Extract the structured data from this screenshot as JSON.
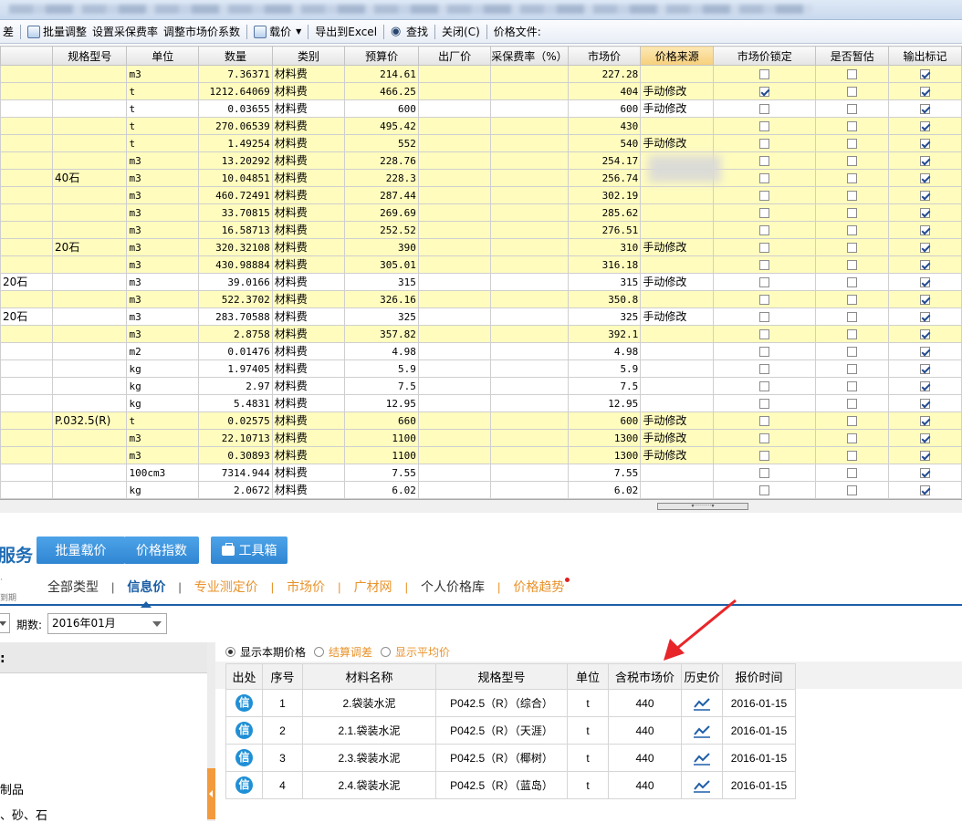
{
  "toolbar": {
    "items": [
      "差",
      "批量调整",
      "设置采保费率",
      "调整市场价系数",
      "载价",
      "导出到Excel",
      "查找",
      "关闭(C)",
      "价格文件:"
    ]
  },
  "grid": {
    "headers": [
      "",
      "规格型号",
      "单位",
      "数量",
      "类别",
      "预算价",
      "出厂价",
      "采保费率（%）",
      "市场价",
      "价格来源",
      "市场价锁定",
      "是否暂估",
      "输出标记"
    ],
    "rows": [
      {
        "name": "",
        "spec": "",
        "unit": "m3",
        "qty": "7.36371",
        "cat": "材料费",
        "budget": "214.61",
        "market": "227.28",
        "src": "",
        "lock": false,
        "est": false,
        "out": true,
        "bg": "y"
      },
      {
        "name": "",
        "spec": "",
        "unit": "t",
        "qty": "1212.64069",
        "cat": "材料费",
        "budget": "466.25",
        "market": "404",
        "src": "手动修改",
        "lock": true,
        "est": false,
        "out": true,
        "bg": "y"
      },
      {
        "name": "",
        "spec": "",
        "unit": "t",
        "qty": "0.03655",
        "cat": "材料费",
        "budget": "600",
        "market": "600",
        "src": "手动修改",
        "lock": false,
        "est": false,
        "out": true,
        "bg": "w"
      },
      {
        "name": "",
        "spec": "",
        "unit": "t",
        "qty": "270.06539",
        "cat": "材料费",
        "budget": "495.42",
        "market": "430",
        "src": "",
        "lock": false,
        "est": false,
        "out": true,
        "bg": "y"
      },
      {
        "name": "",
        "spec": "",
        "unit": "t",
        "qty": "1.49254",
        "cat": "材料费",
        "budget": "552",
        "market": "540",
        "src": "手动修改",
        "lock": false,
        "est": false,
        "out": true,
        "bg": "y"
      },
      {
        "name": "",
        "spec": "",
        "unit": "m3",
        "qty": "13.20292",
        "cat": "材料费",
        "budget": "228.76",
        "market": "254.17",
        "src": "",
        "lock": false,
        "est": false,
        "out": true,
        "bg": "y"
      },
      {
        "name": "",
        "spec": "40石",
        "unit": "m3",
        "qty": "10.04851",
        "cat": "材料费",
        "budget": "228.3",
        "market": "256.74",
        "src": "",
        "lock": false,
        "est": false,
        "out": true,
        "bg": "y"
      },
      {
        "name": "",
        "spec": "",
        "unit": "m3",
        "qty": "460.72491",
        "cat": "材料费",
        "budget": "287.44",
        "market": "302.19",
        "src": "",
        "lock": false,
        "est": false,
        "out": true,
        "bg": "y"
      },
      {
        "name": "",
        "spec": "",
        "unit": "m3",
        "qty": "33.70815",
        "cat": "材料费",
        "budget": "269.69",
        "market": "285.62",
        "src": "",
        "lock": false,
        "est": false,
        "out": true,
        "bg": "y"
      },
      {
        "name": "",
        "spec": "",
        "unit": "m3",
        "qty": "16.58713",
        "cat": "材料费",
        "budget": "252.52",
        "market": "276.51",
        "src": "",
        "lock": false,
        "est": false,
        "out": true,
        "bg": "y"
      },
      {
        "name": "",
        "spec": "20石",
        "unit": "m3",
        "qty": "320.32108",
        "cat": "材料费",
        "budget": "390",
        "market": "310",
        "src": "手动修改",
        "lock": false,
        "est": false,
        "out": true,
        "bg": "y"
      },
      {
        "name": "",
        "spec": "",
        "unit": "m3",
        "qty": "430.98884",
        "cat": "材料费",
        "budget": "305.01",
        "market": "316.18",
        "src": "",
        "lock": false,
        "est": false,
        "out": true,
        "bg": "y"
      },
      {
        "name": "20石",
        "spec": "",
        "unit": "m3",
        "qty": "39.0166",
        "cat": "材料费",
        "budget": "315",
        "market": "315",
        "src": "手动修改",
        "lock": false,
        "est": false,
        "out": true,
        "bg": "w"
      },
      {
        "name": "",
        "spec": "",
        "unit": "m3",
        "qty": "522.3702",
        "cat": "材料费",
        "budget": "326.16",
        "market": "350.8",
        "src": "",
        "lock": false,
        "est": false,
        "out": true,
        "bg": "y"
      },
      {
        "name": "20石",
        "spec": "",
        "unit": "m3",
        "qty": "283.70588",
        "cat": "材料费",
        "budget": "325",
        "market": "325",
        "src": "手动修改",
        "lock": false,
        "est": false,
        "out": true,
        "bg": "w"
      },
      {
        "name": "",
        "spec": "",
        "unit": "m3",
        "qty": "2.8758",
        "cat": "材料费",
        "budget": "357.82",
        "market": "392.1",
        "src": "",
        "lock": false,
        "est": false,
        "out": true,
        "bg": "y"
      },
      {
        "name": "",
        "spec": "",
        "unit": "m2",
        "qty": "0.01476",
        "cat": "材料费",
        "budget": "4.98",
        "market": "4.98",
        "src": "",
        "lock": false,
        "est": false,
        "out": true,
        "bg": "w"
      },
      {
        "name": "",
        "spec": "",
        "unit": "kg",
        "qty": "1.97405",
        "cat": "材料费",
        "budget": "5.9",
        "market": "5.9",
        "src": "",
        "lock": false,
        "est": false,
        "out": true,
        "bg": "w"
      },
      {
        "name": "",
        "spec": "",
        "unit": "kg",
        "qty": "2.97",
        "cat": "材料费",
        "budget": "7.5",
        "market": "7.5",
        "src": "",
        "lock": false,
        "est": false,
        "out": true,
        "bg": "w"
      },
      {
        "name": "",
        "spec": "",
        "unit": "kg",
        "qty": "5.4831",
        "cat": "材料费",
        "budget": "12.95",
        "market": "12.95",
        "src": "",
        "lock": false,
        "est": false,
        "out": true,
        "bg": "w"
      },
      {
        "name": "",
        "spec": "P.032.5(R)",
        "unit": "t",
        "qty": "0.02575",
        "cat": "材料费",
        "budget": "660",
        "market": "600",
        "src": "手动修改",
        "lock": false,
        "est": false,
        "out": true,
        "bg": "y"
      },
      {
        "name": "",
        "spec": "",
        "unit": "m3",
        "qty": "22.10713",
        "cat": "材料费",
        "budget": "1100",
        "market": "1300",
        "src": "手动修改",
        "lock": false,
        "est": false,
        "out": true,
        "bg": "y"
      },
      {
        "name": "",
        "spec": "",
        "unit": "m3",
        "qty": "0.30893",
        "cat": "材料费",
        "budget": "1100",
        "market": "1300",
        "src": "手动修改",
        "lock": false,
        "est": false,
        "out": true,
        "bg": "y"
      },
      {
        "name": "",
        "spec": "",
        "unit": "100cm3",
        "qty": "7314.944",
        "cat": "材料费",
        "budget": "7.55",
        "market": "7.55",
        "src": "",
        "lock": false,
        "est": false,
        "out": true,
        "bg": "w"
      },
      {
        "name": "",
        "spec": "",
        "unit": "kg",
        "qty": "2.0672",
        "cat": "材料费",
        "budget": "6.02",
        "market": "6.02",
        "src": "",
        "lock": false,
        "est": false,
        "out": true,
        "bg": "w"
      }
    ]
  },
  "service": {
    "title": "服务",
    "btn_load": "批量载价",
    "btn_index": "价格指数",
    "btn_tools": "工具箱",
    "tiny1": "·",
    "tiny2": "到期"
  },
  "tabs": [
    "全部类型",
    "信息价",
    "专业测定价",
    "市场价",
    "广材网",
    "个人价格库",
    "价格趋势"
  ],
  "filter": {
    "period_label": "期数:",
    "period_value": "2016年01月"
  },
  "left_panel": {
    "head": ":",
    "item1": "制品",
    "item2": "、砂、石"
  },
  "radios": [
    "显示本期价格",
    "结算调差",
    "显示平均价"
  ],
  "info_table": {
    "headers": [
      "出处",
      "序号",
      "材料名称",
      "规格型号",
      "单位",
      "含税市场价",
      "历史价",
      "报价时间"
    ],
    "badge": "信",
    "rows": [
      {
        "no": "1",
        "name": "2.袋装水泥",
        "spec": "P042.5（R）（综合）",
        "unit": "t",
        "price": "440",
        "date": "2016-01-15"
      },
      {
        "no": "2",
        "name": "2.1.袋装水泥",
        "spec": "P042.5（R）（天涯）",
        "unit": "t",
        "price": "440",
        "date": "2016-01-15"
      },
      {
        "no": "3",
        "name": "2.3.袋装水泥",
        "spec": "P042.5（R）（椰树）",
        "unit": "t",
        "price": "440",
        "date": "2016-01-15"
      },
      {
        "no": "4",
        "name": "2.4.袋装水泥",
        "spec": "P042.5（R）（蓝岛）",
        "unit": "t",
        "price": "440",
        "date": "2016-01-15"
      }
    ]
  },
  "colors": {
    "accent": "#1f6db5",
    "orange": "#e8932c",
    "highlight_row": "#fffcbe",
    "arrow": "#e8262a"
  }
}
